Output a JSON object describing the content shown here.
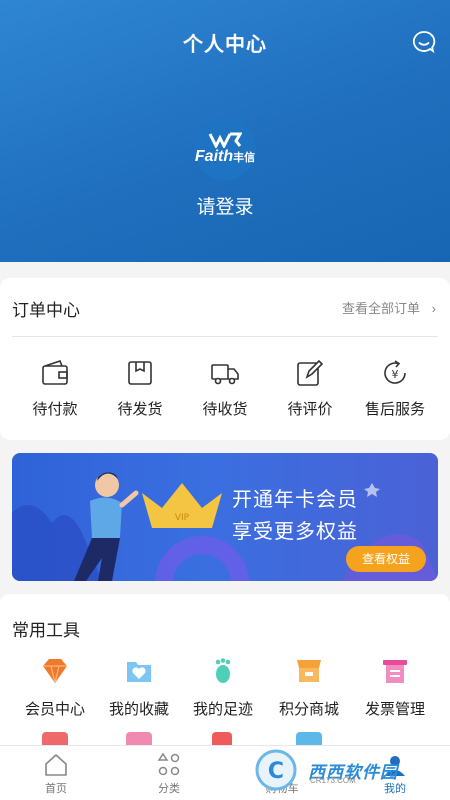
{
  "header": {
    "title": "个人中心",
    "icon": "chat-icon"
  },
  "profile": {
    "logo_mark": "Faith",
    "logo_text": "丰信",
    "login_label": "请登录"
  },
  "orders": {
    "title": "订单中心",
    "view_all": "查看全部订单",
    "items": [
      {
        "label": "待付款",
        "icon": "wallet-icon"
      },
      {
        "label": "待发货",
        "icon": "box-icon"
      },
      {
        "label": "待收货",
        "icon": "truck-icon"
      },
      {
        "label": "待评价",
        "icon": "edit-icon"
      },
      {
        "label": "售后服务",
        "icon": "refund-icon"
      }
    ]
  },
  "banner": {
    "line1": "开通年卡会员",
    "line2": "享受更多权益",
    "button": "查看权益",
    "badge": "VIP"
  },
  "tools": {
    "title": "常用工具",
    "items": [
      {
        "label": "会员中心",
        "icon": "diamond-icon"
      },
      {
        "label": "我的收藏",
        "icon": "heart-folder-icon"
      },
      {
        "label": "我的足迹",
        "icon": "footprint-icon"
      },
      {
        "label": "积分商城",
        "icon": "shop-icon"
      },
      {
        "label": "发票管理",
        "icon": "invoice-icon"
      }
    ]
  },
  "tabbar": {
    "items": [
      {
        "label": "首页",
        "icon": "home-icon"
      },
      {
        "label": "分类",
        "icon": "category-icon"
      },
      {
        "label": "购物车",
        "icon": "cart-icon"
      },
      {
        "label": "我的",
        "icon": "user-icon"
      }
    ]
  },
  "watermark": {
    "text": "西西软件园",
    "sub": "CR173.COM"
  },
  "colors": {
    "primary": "#1f6fbe",
    "accent": "#f5a31e",
    "banner": "#3a6fe0"
  }
}
